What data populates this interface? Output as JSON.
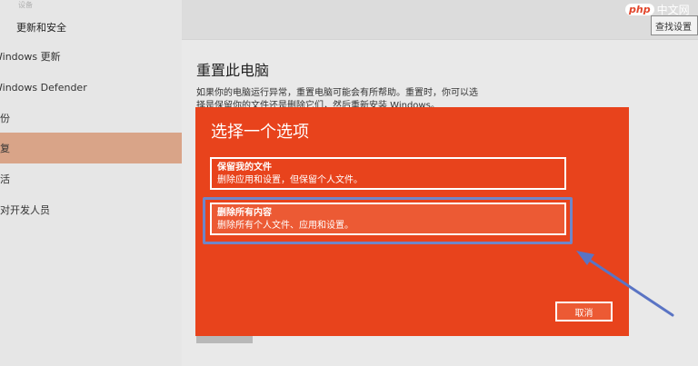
{
  "sidebar": {
    "faded_top": "设备",
    "section_header": "更新和安全",
    "items": [
      {
        "label": "Windows 更新"
      },
      {
        "label": "Windows Defender"
      },
      {
        "label": "备份"
      },
      {
        "label": "恢复"
      },
      {
        "label": "激活"
      },
      {
        "label": "针对开发人员"
      }
    ]
  },
  "topbar": {
    "search_label": "查找设置"
  },
  "watermark": {
    "logo": "php",
    "text": "中文网"
  },
  "main": {
    "title": "重置此电脑",
    "description": "如果你的电脑运行异常，重置电脑可能会有所帮助。重置时，你可以选择是保留你的文件还是删除它们，然后重新安装 Windows。"
  },
  "dialog": {
    "title": "选择一个选项",
    "options": [
      {
        "title": "保留我的文件",
        "desc": "删除应用和设置，但保留个人文件。"
      },
      {
        "title": "删除所有内容",
        "desc": "删除所有个人文件、应用和设置。"
      }
    ],
    "cancel_label": "取消"
  },
  "colors": {
    "dialog_bg": "#e8431c",
    "sidebar_selected": "#d9a488",
    "highlight": "#6f86c8"
  }
}
